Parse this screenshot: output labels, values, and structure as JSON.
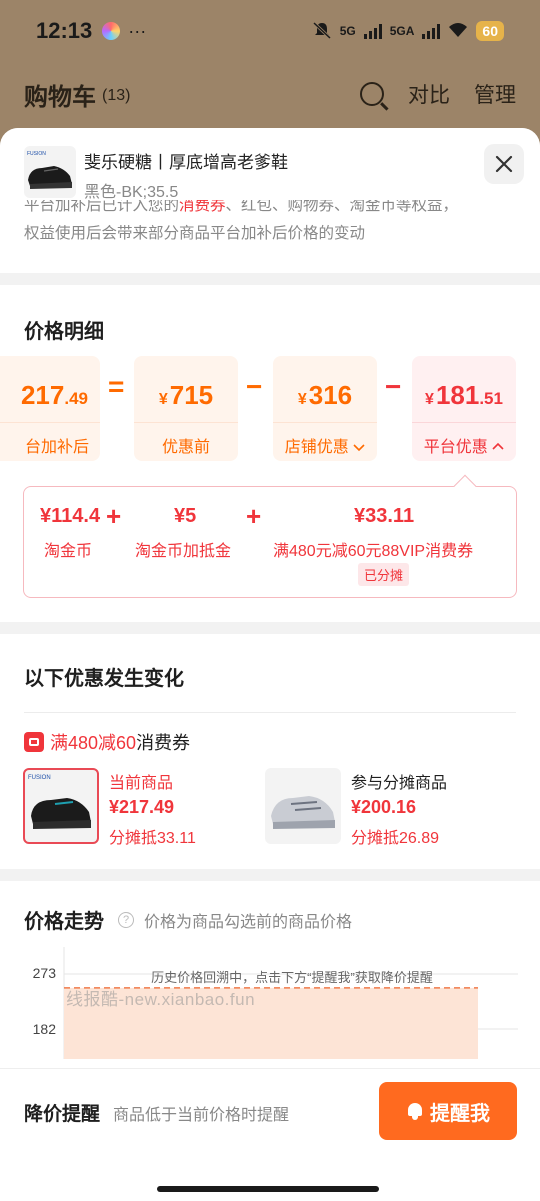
{
  "status_bar": {
    "time": "12:13",
    "more": "···",
    "net1": "5G",
    "net2": "5GA",
    "battery": "60"
  },
  "cart_header": {
    "title": "购物车",
    "count": "(13)",
    "compare": "对比",
    "manage": "管理"
  },
  "product": {
    "name": "斐乐硬糖丨厚底增高老爹鞋",
    "sku": "黑色-BK;35.5",
    "brand_logo": "FUSION"
  },
  "notice": {
    "line1_a": "平台加补后已计入您的",
    "line1_hl": "消费券",
    "line1_b": "、红包、购物券、淘金币等权益，",
    "line2": "权益使用后会带来部分商品平台加补后价格的变动"
  },
  "price_detail": {
    "title": "价格明细",
    "final": {
      "int": "217",
      "dec": ".49",
      "label": "台加补后"
    },
    "eq": "=",
    "original": {
      "cur": "¥",
      "int": "715",
      "label": "优惠前"
    },
    "minus": "−",
    "shop": {
      "cur": "¥",
      "int": "316",
      "label": "店铺优惠"
    },
    "platform": {
      "cur": "¥",
      "int": "181",
      "dec": ".51",
      "label": "平台优惠"
    },
    "platform_items": [
      {
        "value": "¥114.4",
        "label": "淘金币"
      },
      {
        "value": "¥5",
        "label": "淘金币加抵金"
      },
      {
        "value": "¥33.11",
        "label": "满480元减60元88VIP消费券",
        "tag": "已分摊"
      }
    ],
    "plus": "+"
  },
  "change": {
    "title": "以下优惠发生变化",
    "coupon_red": "满480减60",
    "coupon_text": "消费券",
    "items": [
      {
        "title": "当前商品",
        "price": "¥217.49",
        "share": "分摊抵33.11"
      },
      {
        "title": "参与分摊商品",
        "price": "¥200.16",
        "share": "分摊抵26.89"
      }
    ]
  },
  "trend": {
    "title": "价格走势",
    "hint": "价格为商品勾选前的商品价格",
    "annotation": "历史价格回溯中，点击下方“提醒我”获取降价提醒",
    "y_ticks": [
      "273",
      "182"
    ]
  },
  "chart_data": {
    "type": "area",
    "title": "价格走势",
    "y_ticks": [
      273,
      182
    ],
    "series": [
      {
        "values": [
          250,
          250
        ]
      }
    ],
    "annotation": "历史价格回溯中，点击下方“提醒我”获取降价提醒"
  },
  "reminder": {
    "title": "降价提醒",
    "desc": "商品低于当前价格时提醒",
    "button": "提醒我"
  },
  "watermark": "线报酷-new.xianbao.fun",
  "colors": {
    "accent_orange": "#ff6a00",
    "accent_red": "#f0353b",
    "button": "#ff6a1f"
  }
}
